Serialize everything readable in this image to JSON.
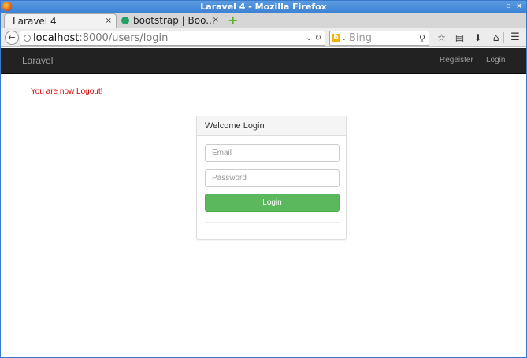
{
  "window": {
    "title": "Laravel 4 - Mozilla Firefox",
    "controls": [
      "_",
      "▫",
      "×"
    ]
  },
  "tabs": [
    {
      "label": "Laravel 4",
      "close": "×",
      "active": true
    },
    {
      "label": "bootstrap | Boo...",
      "close": "×",
      "active": false
    }
  ],
  "new_tab": "+",
  "url": {
    "host": "localhost",
    "path": ":8000/users/login"
  },
  "search": {
    "engine_icon": "b",
    "placeholder": "Bing"
  },
  "toolbar_icons": [
    "star-icon",
    "clipboard-icon",
    "download-icon",
    "home-icon",
    "menu-icon"
  ],
  "app": {
    "brand": "Laravel",
    "nav": {
      "register": "Regeister",
      "login": "Login"
    },
    "flash_message": "You are now Logout!",
    "flash_color": "#d40000"
  },
  "login_panel": {
    "heading": "Welcome Login",
    "email_placeholder": "Email",
    "password_placeholder": "Password",
    "submit_label": "Login",
    "submit_color": "#5cb85c"
  }
}
